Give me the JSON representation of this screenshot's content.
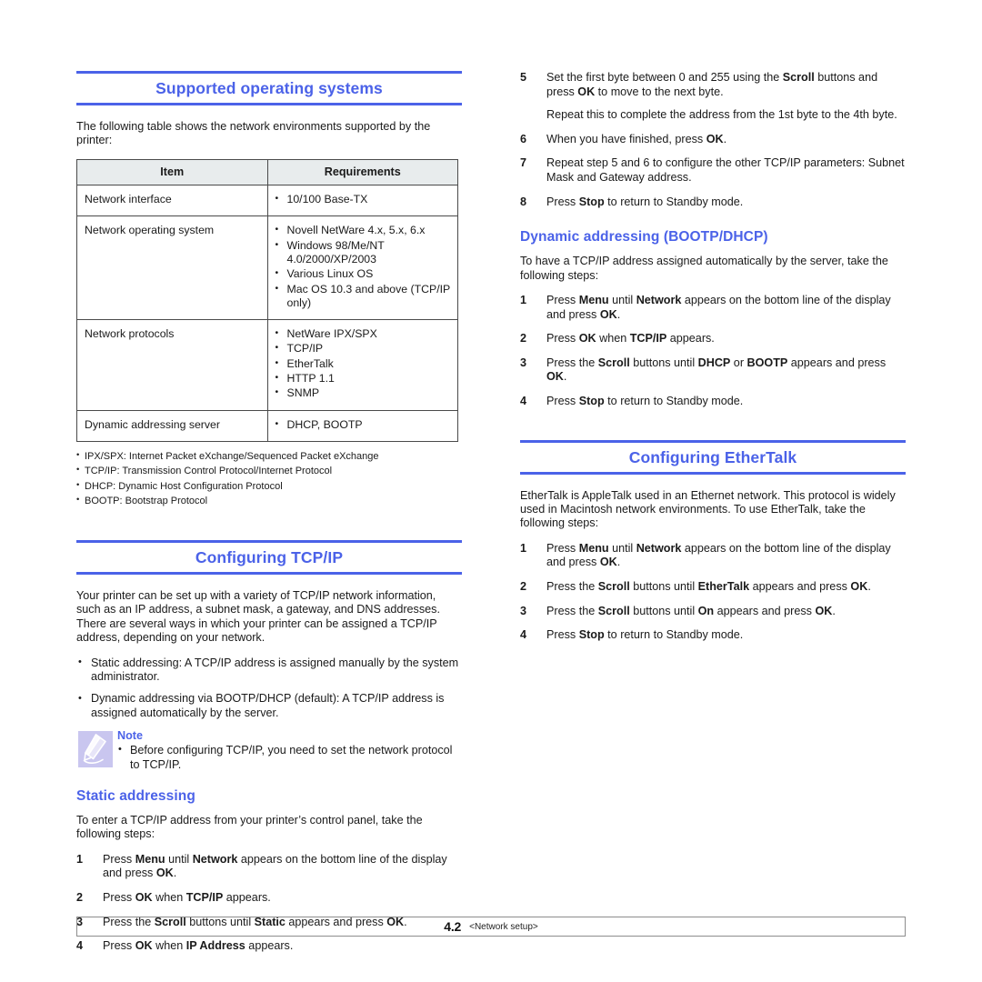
{
  "colors": {
    "heading_blue": "#4b62e8",
    "table_header_fill": "#e8eced",
    "note_icon_fill": "#c9c6ef",
    "rule": "#4b62e8",
    "border": "#4a4a4a"
  },
  "left_column": {
    "section1": {
      "heading": "Supported operating systems",
      "intro": "The following table shows the network environments supported by the printer:",
      "table": {
        "headers": [
          "Item",
          "Requirements"
        ],
        "rows": [
          {
            "item": "Network interface",
            "requirements": [
              "10/100 Base-TX"
            ]
          },
          {
            "item": "Network operating system",
            "requirements": [
              "Novell NetWare 4.x, 5.x, 6.x",
              "Windows 98/Me/NT 4.0/2000/XP/2003",
              "Various Linux OS",
              "Mac OS 10.3 and above (TCP/IP only)"
            ]
          },
          {
            "item": "Network protocols",
            "requirements": [
              "NetWare IPX/SPX",
              "TCP/IP",
              "EtherTalk",
              "HTTP 1.1",
              "SNMP"
            ]
          },
          {
            "item": "Dynamic addressing server",
            "requirements": [
              "DHCP, BOOTP"
            ]
          }
        ]
      },
      "footnotes": [
        "IPX/SPX: Internet Packet eXchange/Sequenced Packet eXchange",
        "TCP/IP: Transmission Control Protocol/Internet Protocol",
        "DHCP: Dynamic Host Configuration Protocol",
        "BOOTP: Bootstrap Protocol"
      ]
    },
    "section2": {
      "heading": "Configuring TCP/IP",
      "intro": "Your printer can be set up with a variety of TCP/IP network information, such as an IP address, a subnet mask, a gateway, and DNS addresses. There are several ways in which your printer can be assigned a TCP/IP address, depending on your network.",
      "bullets": [
        "Static addressing: A TCP/IP address is assigned manually by the system administrator.",
        "Dynamic addressing via BOOTP/DHCP (default): A TCP/IP address is assigned automatically by the server."
      ],
      "note": {
        "title": "Note",
        "icon": "pencil-note-icon",
        "items": [
          "Before configuring TCP/IP, you need to set the network protocol to TCP/IP."
        ]
      },
      "subsection": {
        "heading": "Static addressing",
        "intro": "To enter a TCP/IP address from your printer’s control panel, take the following steps:",
        "steps": [
          {
            "num": "1",
            "html": "Press <b>Menu</b> until <b>Network</b> appears on the bottom line of the display and press <b>OK</b>."
          },
          {
            "num": "2",
            "html": "Press <b>OK</b> when <b>TCP/IP</b> appears."
          },
          {
            "num": "3",
            "html": "Press the <b>Scroll</b> buttons until <b>Static</b> appears and press <b>OK</b>."
          },
          {
            "num": "4",
            "html": "Press <b>OK</b> when <b>IP Address</b> appears."
          }
        ]
      }
    }
  },
  "right_column": {
    "continued_steps": [
      {
        "num": "5",
        "html": "Set the first byte between 0 and 255 using the <b>Scroll</b> buttons and press <b>OK</b> to move to the next byte.",
        "sub": "Repeat this to complete the address from the 1st byte to the 4th byte."
      },
      {
        "num": "6",
        "html": "When you have finished, press <b>OK</b>."
      },
      {
        "num": "7",
        "html": "Repeat step 5 and 6 to configure the other TCP/IP parameters: Subnet Mask and Gateway address."
      },
      {
        "num": "8",
        "html": "Press <b>Stop</b> to return to Standby mode."
      }
    ],
    "section_dynamic": {
      "heading": "Dynamic addressing (BOOTP/DHCP)",
      "intro": "To have a TCP/IP address assigned automatically by the server, take the following steps:",
      "steps": [
        {
          "num": "1",
          "html": "Press <b>Menu</b> until <b>Network</b> appears on the bottom line of the display and press <b>OK</b>."
        },
        {
          "num": "2",
          "html": "Press <b>OK</b> when <b>TCP/IP</b> appears."
        },
        {
          "num": "3",
          "html": "Press the <b>Scroll</b> buttons until <b>DHCP</b> or <b>BOOTP</b> appears and press <b>OK</b>."
        },
        {
          "num": "4",
          "html": "Press <b>Stop</b> to return to Standby mode."
        }
      ]
    },
    "section_ethertalk": {
      "heading": "Configuring EtherTalk",
      "intro": "EtherTalk is AppleTalk used in an Ethernet network. This protocol is widely used in Macintosh network environments. To use EtherTalk, take the following steps:",
      "steps": [
        {
          "num": "1",
          "html": "Press <b>Menu</b> until <b>Network</b> appears on the bottom line of the display and press <b>OK</b>."
        },
        {
          "num": "2",
          "html": "Press the <b>Scroll</b> buttons until <b>EtherTalk</b> appears and press <b>OK</b>."
        },
        {
          "num": "3",
          "html": "Press the <b>Scroll</b> buttons until <b>On</b> appears and press <b>OK</b>."
        },
        {
          "num": "4",
          "html": "Press <b>Stop</b> to return to Standby mode."
        }
      ]
    }
  },
  "footer": {
    "page_number": "4.2",
    "section_label": "<Network setup>"
  }
}
